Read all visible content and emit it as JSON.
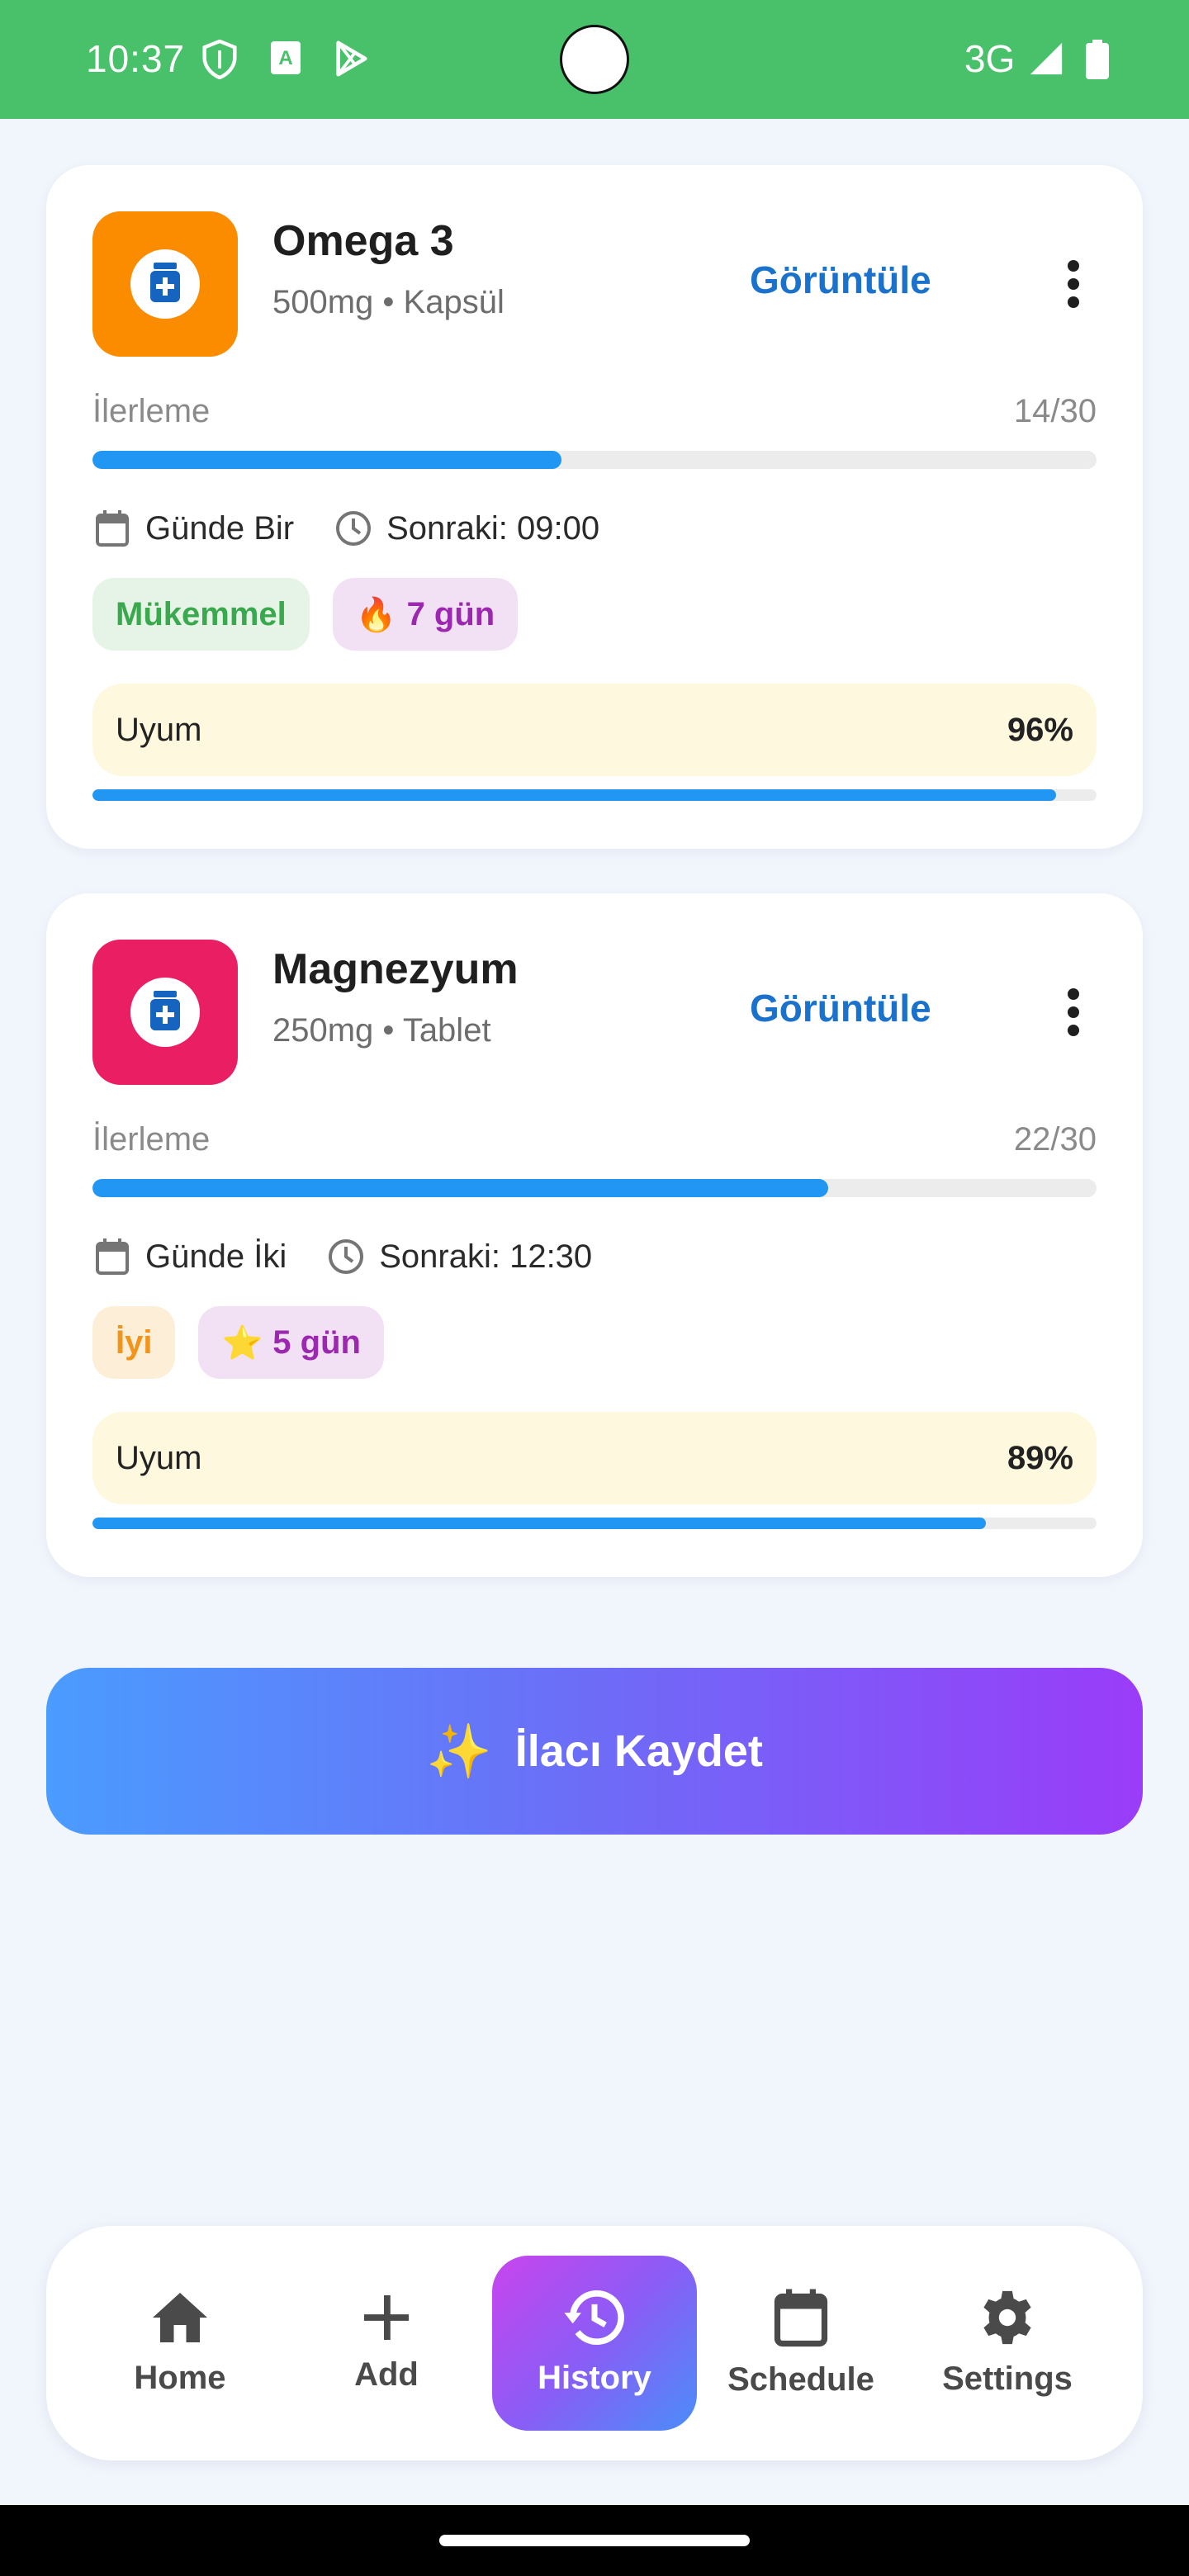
{
  "status_bar": {
    "time": "10:37",
    "network": "3G",
    "icons": [
      "shield-icon",
      "keyboard-a-icon",
      "play-store-icon",
      "signal-icon",
      "battery-icon"
    ]
  },
  "medications": [
    {
      "name": "Omega 3",
      "dose": "500mg • Kapsül",
      "icon_color": "#fb8c00",
      "view_label": "Görüntüle",
      "progress_label": "İlerleme",
      "progress_count": "14/30",
      "progress_fraction": 0.467,
      "frequency": "Günde Bir",
      "next_dose": "Sonraki: 09:00",
      "status_chip": "Mükemmel",
      "streak_emoji": "🔥",
      "streak": "7 gün",
      "adherence_label": "Uyum",
      "adherence_value": "96%",
      "adherence_fraction": 0.96
    },
    {
      "name": "Magnezyum",
      "dose": "250mg • Tablet",
      "icon_color": "#e91e63",
      "view_label": "Görüntüle",
      "progress_label": "İlerleme",
      "progress_count": "22/30",
      "progress_fraction": 0.733,
      "frequency": "Günde İki",
      "next_dose": "Sonraki: 12:30",
      "status_chip": "İyi",
      "streak_emoji": "⭐",
      "streak": "5 gün",
      "adherence_label": "Uyum",
      "adherence_value": "89%",
      "adherence_fraction": 0.89
    }
  ],
  "save_button": {
    "emoji": "✨",
    "label": "İlacı Kaydet"
  },
  "bottom_nav": {
    "items": [
      {
        "label": "Home",
        "icon": "home-icon"
      },
      {
        "label": "Add",
        "icon": "plus-icon"
      },
      {
        "label": "History",
        "icon": "history-icon",
        "active": true
      },
      {
        "label": "Schedule",
        "icon": "calendar-icon"
      },
      {
        "label": "Settings",
        "icon": "gear-icon"
      }
    ]
  },
  "colors": {
    "status_bar": "#48c16a",
    "accent_blue": "#2196f3",
    "link_blue": "#1a72cc",
    "background": "#f1f5fc"
  }
}
